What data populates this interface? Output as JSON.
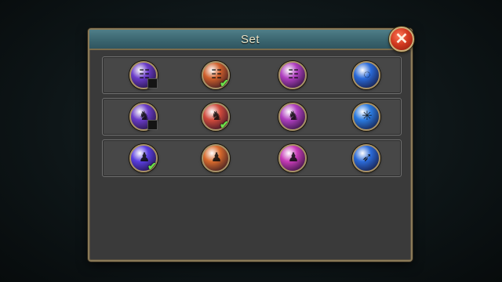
{
  "dialog": {
    "title": "Set",
    "close_label": "✕"
  },
  "colors": {
    "titlebar": "#3b6670",
    "panel": "#3a3a3a",
    "frame": "#8a7a58",
    "check": "#6be04a"
  },
  "rows": [
    {
      "name": "set-row-1",
      "slots": [
        {
          "icon": "purple-rune-skill-icon",
          "color": "#6a3cc8",
          "glyph": "☷",
          "marker": "unchecked"
        },
        {
          "icon": "orange-rune-skill-icon",
          "color": "#d0602c",
          "glyph": "☷",
          "marker": "checked"
        },
        {
          "icon": "magenta-rune-skill-icon",
          "color": "#b040c0",
          "glyph": "☷",
          "marker": "none"
        },
        {
          "icon": "blue-swirl-skill-icon",
          "color": "#2a6ad8",
          "glyph": "◌",
          "marker": "none"
        }
      ]
    },
    {
      "name": "set-row-2",
      "slots": [
        {
          "icon": "purple-beast-skill-icon",
          "color": "#6a3cc8",
          "glyph": "♞",
          "marker": "unchecked"
        },
        {
          "icon": "red-beast-skill-icon",
          "color": "#d04a3c",
          "glyph": "♞",
          "marker": "checked"
        },
        {
          "icon": "magenta-beast-skill-icon",
          "color": "#b040c0",
          "glyph": "♞",
          "marker": "none"
        },
        {
          "icon": "blue-burst-skill-icon",
          "color": "#2a7ae0",
          "glyph": "✳",
          "marker": "none"
        }
      ]
    },
    {
      "name": "set-row-3",
      "slots": [
        {
          "icon": "violet-warrior-skill-icon",
          "color": "#5a3ee0",
          "glyph": "♟",
          "marker": "checked"
        },
        {
          "icon": "orange-warrior-skill-icon",
          "color": "#d86a2c",
          "glyph": "♟",
          "marker": "none"
        },
        {
          "icon": "pink-warrior-skill-icon",
          "color": "#c83cb8",
          "glyph": "♟",
          "marker": "none"
        },
        {
          "icon": "blue-slash-skill-icon",
          "color": "#2a6ad8",
          "glyph": "➶",
          "marker": "none"
        }
      ]
    }
  ]
}
